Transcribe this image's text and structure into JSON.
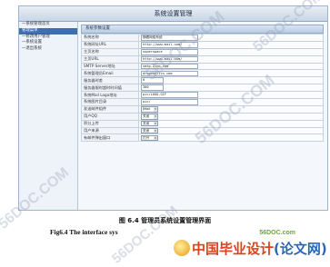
{
  "window": {
    "title": "系统设置管理"
  },
  "sidebar": {
    "items": [
      {
        "label": "一系统管理首页"
      },
      {
        "label": "管理菜单"
      },
      {
        "label": "一修改用户管理"
      },
      {
        "label": "一系统设置"
      },
      {
        "label": "一退出系统"
      }
    ],
    "active_index": 1
  },
  "panel": {
    "title": "系统参数设置"
  },
  "form": {
    "rows": [
      {
        "label": "系统名称",
        "value": "随着网络系统",
        "kind": "input"
      },
      {
        "label": "系统网址URL",
        "value": "http://www.mail.com/",
        "kind": "input"
      },
      {
        "label": "主页名称",
        "value": "superspace",
        "kind": "input"
      },
      {
        "label": "主页URL",
        "value": "http://www.mail.com/",
        "kind": "input"
      },
      {
        "label": "SMTP Server地址",
        "value": "smtp.21cn.com",
        "kind": "input"
      },
      {
        "label": "系统管理员Email",
        "value": "dragon@21cn.com",
        "kind": "input"
      },
      {
        "label": "服务器时差",
        "value": "0",
        "kind": "input-short"
      },
      {
        "label": "服务器限时超时时间值",
        "value": "300",
        "kind": "input-short"
      },
      {
        "label": "系统Mail Logo地址",
        "value": "pic/LOGO.GIF",
        "kind": "input"
      },
      {
        "label": "系统图片目录",
        "value": "pic/",
        "kind": "input"
      },
      {
        "label": "发送邮件组件",
        "value": "JMail",
        "kind": "select"
      },
      {
        "label": "用户QQ",
        "value": "关闭",
        "kind": "select"
      },
      {
        "label": "积分上传",
        "value": "关闭",
        "kind": "select"
      },
      {
        "label": "用户来源",
        "value": "关闭",
        "kind": "select"
      },
      {
        "label": "有邮件弹出窗口",
        "value": "打开",
        "kind": "select"
      }
    ]
  },
  "captions": {
    "cn": "图 6.4 管理员系统设置管理界面",
    "en": "Fig6.4 The interface sys"
  },
  "watermarks": [
    "56DOC.COM",
    "56DOC.COM",
    "56DOC.COM",
    "56DOC.COM",
    "56DOC.COM"
  ],
  "brand": {
    "domain": "56DOC.com",
    "name_red": "中国毕业设计",
    "name_blue": "(论文网)"
  }
}
